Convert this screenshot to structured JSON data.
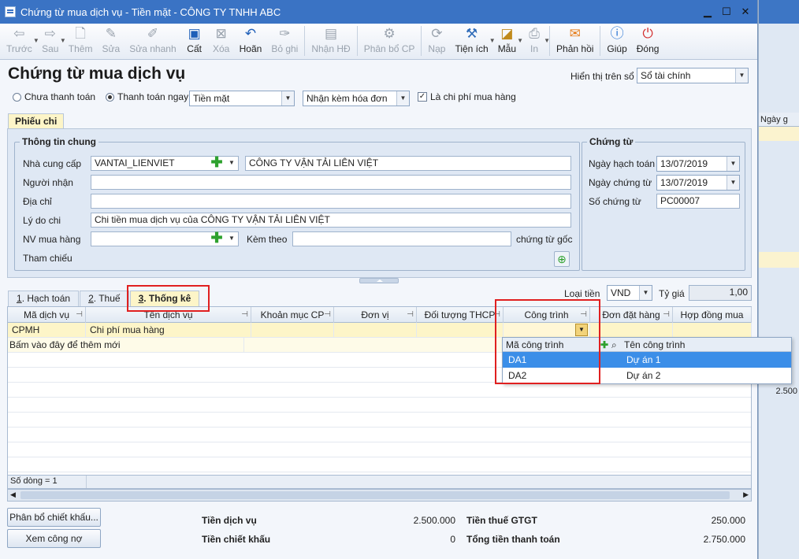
{
  "window": {
    "title": "Chứng từ mua dịch vụ - Tiền mặt - CÔNG TY TNHH ABC"
  },
  "toolbar": {
    "buttons": [
      {
        "label": "Trước",
        "icon": "arrow-left-icon"
      },
      {
        "label": "Sau",
        "icon": "arrow-right-icon"
      },
      {
        "label": "Thêm",
        "icon": "new-document-icon"
      },
      {
        "label": "Sửa",
        "icon": "edit-icon"
      },
      {
        "label": "Sửa nhanh",
        "icon": "quick-edit-icon"
      },
      {
        "label": "Cất",
        "icon": "save-icon"
      },
      {
        "label": "Xóa",
        "icon": "delete-icon"
      },
      {
        "label": "Hoãn",
        "icon": "undo-icon"
      },
      {
        "label": "Bỏ ghi",
        "icon": "unpost-icon"
      },
      {
        "label": "Nhận HĐ",
        "icon": "receive-invoice-icon"
      },
      {
        "label": "Phân bổ CP",
        "icon": "allocate-icon"
      },
      {
        "label": "Nạp",
        "icon": "reload-icon"
      },
      {
        "label": "Tiện ích",
        "icon": "tools-icon"
      },
      {
        "label": "Mẫu",
        "icon": "template-icon"
      },
      {
        "label": "In",
        "icon": "print-icon"
      },
      {
        "label": "Phản hồi",
        "icon": "feedback-icon"
      },
      {
        "label": "Giúp",
        "icon": "help-icon"
      },
      {
        "label": "Đóng",
        "icon": "close-icon"
      }
    ]
  },
  "header": {
    "title": "Chứng từ mua dịch vụ",
    "display_label": "Hiển thị trên sổ",
    "display_value": "Sổ tài chính"
  },
  "payment": {
    "unpaid_label": "Chưa thanh toán",
    "paid_label": "Thanh toán ngay",
    "method_value": "Tiền mặt",
    "invoice_value": "Nhận kèm hóa đơn",
    "purchase_cost_label": "Là chi phí mua hàng",
    "purchase_cost_checked": "✓"
  },
  "top_tab": {
    "label": "Phiếu chi"
  },
  "general": {
    "title": "Thông tin chung",
    "supplier_label": "Nhà cung cấp",
    "supplier_code": "VANTAI_LIENVIET",
    "supplier_name": "CÔNG TY VẬN TẢI LIÊN VIỆT",
    "receiver_label": "Người nhận",
    "receiver_value": "",
    "address_label": "Địa chỉ",
    "address_value": "",
    "reason_label": "Lý do chi",
    "reason_value": "Chi tiền mua dịch vụ của CÔNG TY VẬN TẢI LIÊN VIỆT",
    "staff_label": "NV mua hàng",
    "staff_value": "",
    "attach_label": "Kèm theo",
    "attach_value": "",
    "original_docs_label": "chứng từ gốc",
    "reference_label": "Tham chiếu"
  },
  "voucher": {
    "title": "Chứng từ",
    "posting_date_label": "Ngày hạch toán",
    "posting_date": "13/07/2019",
    "voucher_date_label": "Ngày chứng từ",
    "voucher_date": "13/07/2019",
    "voucher_no_label": "Số chứng từ",
    "voucher_no": "PC00007"
  },
  "detail_tabs": [
    {
      "key": "1",
      "label": "Hạch toán"
    },
    {
      "key": "2",
      "label": "Thuế"
    },
    {
      "key": "3",
      "label": "Thống kê"
    }
  ],
  "currency": {
    "label": "Loại tiền",
    "value": "VND",
    "rate_label": "Tỷ giá",
    "rate_value": "1,00"
  },
  "grid": {
    "columns": [
      "Mã dịch vụ",
      "Tên dịch vụ",
      "Khoản mục CP",
      "Đơn vị",
      "Đối tượng THCP",
      "Công trình",
      "Đơn đặt hàng",
      "Hợp đồng mua"
    ],
    "rows": [
      {
        "code": "CPMH",
        "name": "Chi phí mua hàng"
      }
    ],
    "add_new_hint": "Bấm vào đây để thêm mới",
    "row_count": "Số dòng = 1"
  },
  "project_dropdown": {
    "col_code": "Mã công trình",
    "col_name": "Tên công trình",
    "items": [
      {
        "code": "DA1",
        "name": "Dự án 1"
      },
      {
        "code": "DA2",
        "name": "Dự án 2"
      }
    ]
  },
  "footer": {
    "allocate_discount_button": "Phân bổ chiết khấu...",
    "view_debt_button": "Xem công nợ",
    "service_amount_label": "Tiền dịch vụ",
    "service_amount": "2.500.000",
    "discount_label": "Tiền chiết khấu",
    "discount": "0",
    "vat_label": "Tiền thuế GTGT",
    "vat": "250.000",
    "total_label": "Tổng tiền thanh toán",
    "total": "2.750.000"
  },
  "background_app": {
    "column_header": "Ngày g",
    "amount": "2.500"
  },
  "colors": {
    "title_bar": "#3a73c4",
    "highlight_row": "#fdf5c8",
    "selection": "#3b8ee8",
    "annotation_red": "#e02020"
  }
}
